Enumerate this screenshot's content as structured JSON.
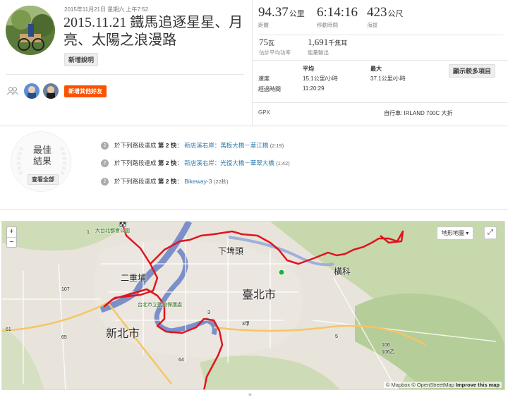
{
  "activity": {
    "date": "2015年11月21日 星期六 上午7:52",
    "title": "2015.11.21 鐵馬追逐星星、月亮、太陽之浪漫路",
    "add_description": "新增說明",
    "add_friends": "新增其他好友"
  },
  "stats": {
    "distance": {
      "value": "94.37",
      "unit": "公里",
      "label": "距離"
    },
    "moving_time": {
      "value": "6:14:16",
      "label": "移動時間"
    },
    "elevation": {
      "value": "423",
      "unit": "公尺",
      "label": "海拔"
    },
    "power": {
      "value": "75",
      "unit": "瓦",
      "label": "估計平均功率"
    },
    "energy": {
      "value": "1,691",
      "unit": "千焦耳",
      "label": "能量輸出"
    },
    "table": {
      "col_avg": "平均",
      "col_max": "最大",
      "speed_label": "速度",
      "speed_avg": "15.1公里/小時",
      "speed_max": "37.1公里/小時",
      "elapsed_label": "經過時間",
      "elapsed_value": "11:20:29"
    },
    "show_more": "顯示較多項目",
    "source": "GPX",
    "bike": "自行車: IRLAND 700C 大折"
  },
  "best_efforts": {
    "title_line1": "最佳",
    "title_line2": "結果",
    "view_all": "查看全部",
    "items": [
      {
        "prefix": "於下列路段達成",
        "rank": "第 2 快",
        "sep": "：",
        "segment": "新店溪右岸：萬板大橋－華江橋",
        "time": "(2:19)"
      },
      {
        "prefix": "於下列路段達成",
        "rank": "第 2 快",
        "sep": "：",
        "segment": "新店溪右岸：光復大橋－華翠大橋",
        "time": "(1:42)"
      },
      {
        "prefix": "於下列路段達成",
        "rank": "第 2 快",
        "sep": "：",
        "segment": "Bikeway-3",
        "time": "(22秒)"
      }
    ]
  },
  "map": {
    "zoom_in": "+",
    "zoom_out": "−",
    "map_type": "地形地圖",
    "fullscreen": "⤢",
    "attribution_1": "© Mapbox © OpenStreetMap",
    "attribution_2": "Improve this map",
    "labels": {
      "sanchong": "二重埔",
      "xiapitou": "下埤頭",
      "taipei": "臺北市",
      "xinbei": "新北市",
      "hengke": "橫科",
      "dataipei": "大台北都會公園",
      "park2": "台北市立動物保護處",
      "road1": "107",
      "road2": "65",
      "road3": "64",
      "road4": "3",
      "road5": "3甲",
      "road6": "106",
      "road7": "106乙",
      "road8": "5",
      "road9": "1",
      "road10": "61"
    },
    "colors": {
      "route": "#e0141e",
      "river": "#7b8fc8",
      "start": "#1fb03a"
    }
  },
  "handle": "≡"
}
